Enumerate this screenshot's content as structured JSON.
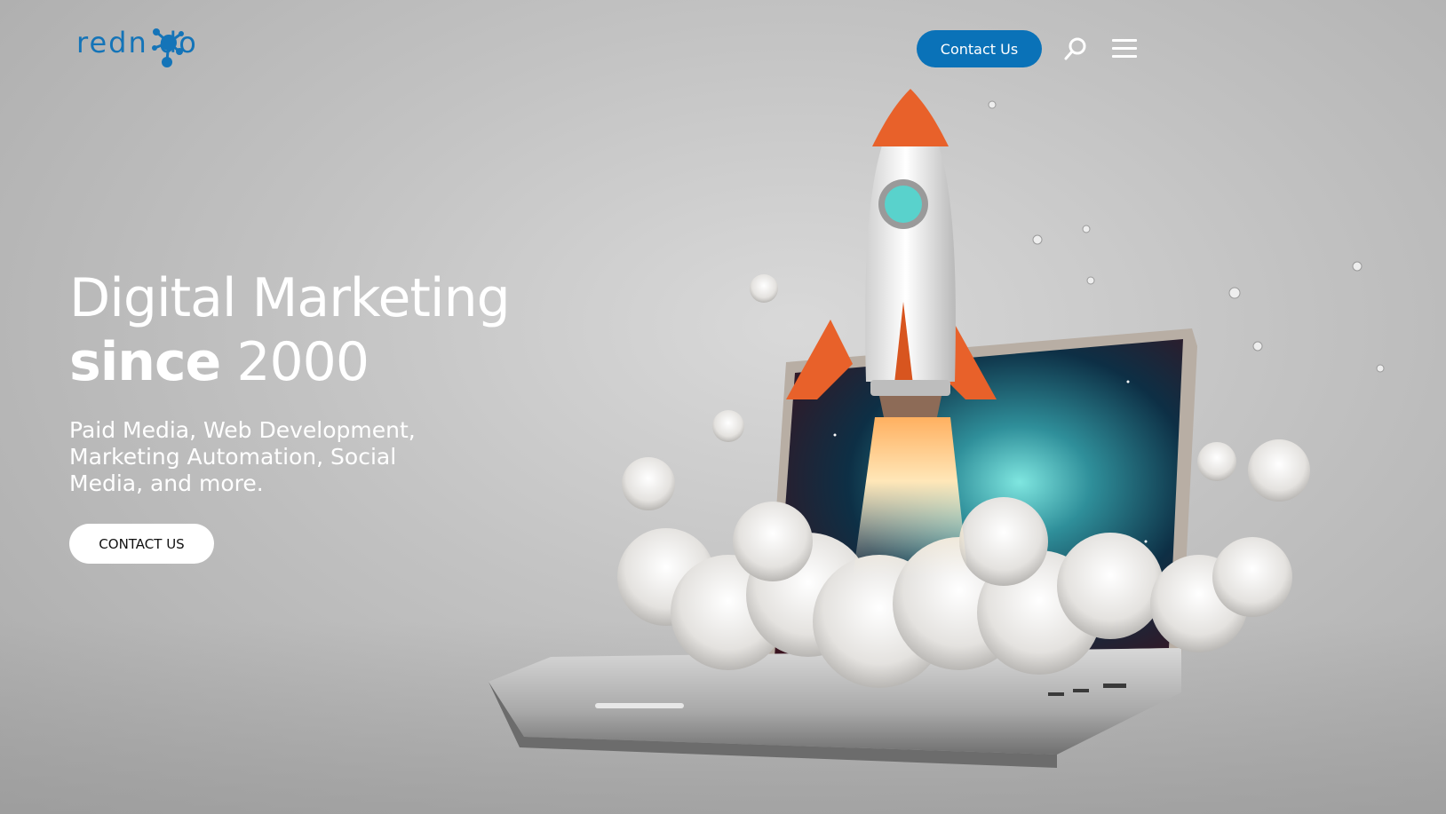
{
  "header": {
    "logo_text": "redn  do",
    "contact_label": "Contact Us",
    "search_icon": "search-icon",
    "menu_icon": "hamburger-menu-icon"
  },
  "hero": {
    "headline_line1": "Digital Marketing",
    "headline_bold": "since",
    "headline_year": " 2000",
    "subtext": "Paid Media, Web Development, Marketing Automation, Social Media, and more.",
    "cta_label": "CONTACT US"
  },
  "colors": {
    "brand_blue": "#0a72b8",
    "rocket_orange": "#e8612a",
    "hero_text": "#ffffff"
  }
}
